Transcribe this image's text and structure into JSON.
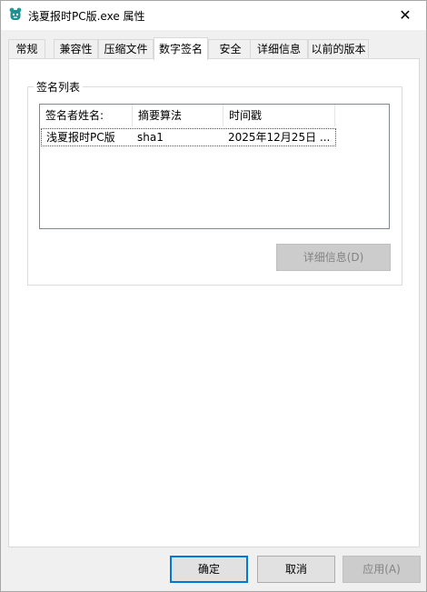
{
  "window": {
    "title": "浅夏报时PC版.exe 属性",
    "close_symbol": "✕"
  },
  "tabs": [
    {
      "label": "常规"
    },
    {
      "label": "兼容性"
    },
    {
      "label": "压缩文件"
    },
    {
      "label": "数字签名"
    },
    {
      "label": "安全"
    },
    {
      "label": "详细信息"
    },
    {
      "label": "以前的版本"
    }
  ],
  "active_tab": "数字签名",
  "signature_group": {
    "legend": "签名列表",
    "columns": [
      "签名者姓名:",
      "摘要算法",
      "时间戳"
    ],
    "rows": [
      {
        "signer": "浅夏报时PC版",
        "algorithm": "sha1",
        "timestamp": "2025年12月25日 ..."
      }
    ],
    "details_button": "详细信息(D)"
  },
  "footer": {
    "ok": "确定",
    "cancel": "取消",
    "apply": "应用(A)"
  },
  "colors": {
    "accent": "#0078d7",
    "window_bg": "#f0f0f0"
  }
}
